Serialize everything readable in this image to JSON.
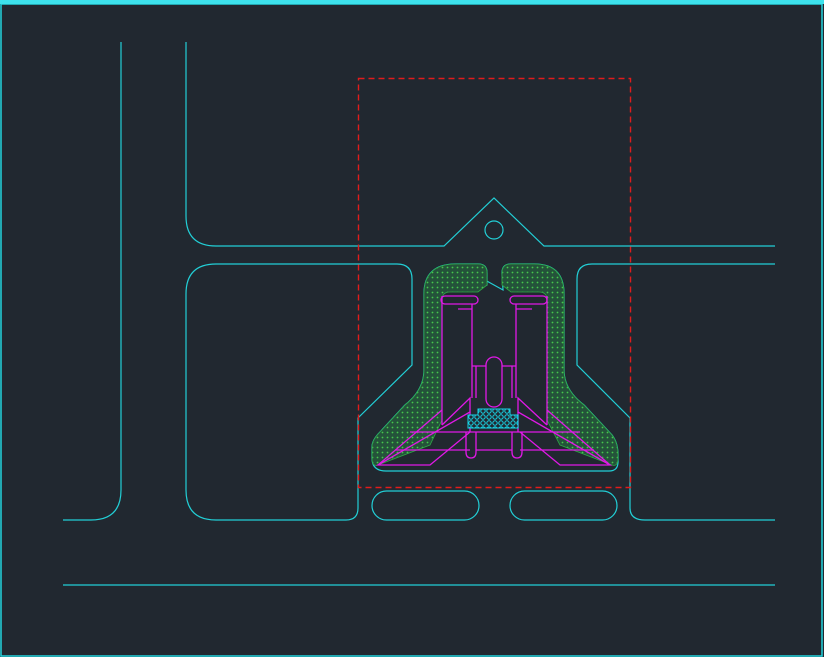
{
  "canvas": {
    "background": "#212830",
    "frame_color": "#22d3dc",
    "top_edge_color": "#3de2ec"
  },
  "colors": {
    "outline": "#22cfd6",
    "selection": "#e01c1c",
    "part": "#e019e6",
    "hatch_fill": "#24533a",
    "hatch_dot": "#46c84c",
    "hatch_edge": "#2ea845",
    "grid_hatch": "#17d4e6"
  },
  "icons": {
    "selection": "dashed-selection-rectangle-icon",
    "hole": "circle-hole-icon"
  }
}
